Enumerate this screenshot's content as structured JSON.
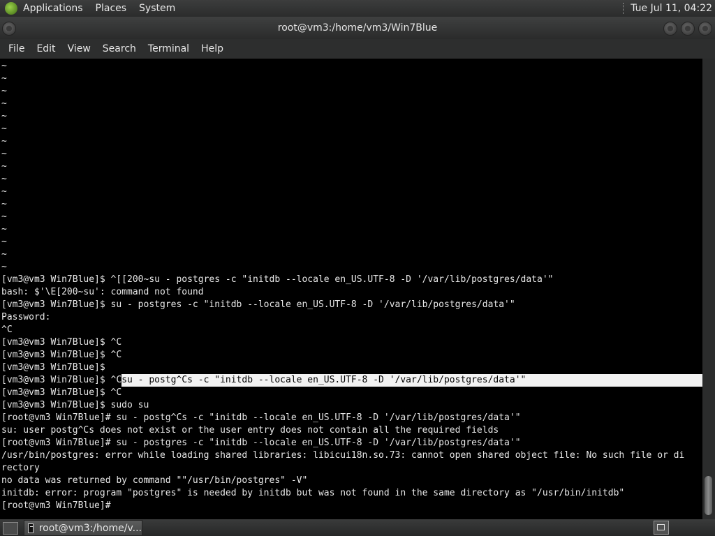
{
  "top_panel": {
    "menus": [
      "Applications",
      "Places",
      "System"
    ],
    "clock": "Tue Jul 11, 04:22"
  },
  "window": {
    "title": "root@vm3:/home/vm3/Win7Blue"
  },
  "menubar": {
    "items": [
      "File",
      "Edit",
      "View",
      "Search",
      "Terminal",
      "Help"
    ]
  },
  "terminal": {
    "lines": [
      "~",
      "~",
      "~",
      "~",
      "~",
      "~",
      "~",
      "~",
      "~",
      "~",
      "~",
      "~",
      "~",
      "~",
      "~",
      "~",
      "~",
      "[vm3@vm3 Win7Blue]$ ^[[200~su - postgres -c \"initdb --locale en_US.UTF-8 -D '/var/lib/postgres/data'\"",
      "bash: $'\\E[200~su': command not found",
      "[vm3@vm3 Win7Blue]$ su - postgres -c \"initdb --locale en_US.UTF-8 -D '/var/lib/postgres/data'\"",
      "Password:",
      "^C",
      "[vm3@vm3 Win7Blue]$ ^C",
      "[vm3@vm3 Win7Blue]$ ^C",
      "[vm3@vm3 Win7Blue]$ ",
      "[vm3@vm3 Win7Blue]$ ^C",
      "[vm3@vm3 Win7Blue]$ ^C",
      "[vm3@vm3 Win7Blue]$ sudo su",
      "[root@vm3 Win7Blue]# su - postg^Cs -c \"initdb --locale en_US.UTF-8 -D '/var/lib/postgres/data'\"",
      "su: user postg^Cs does not exist or the user entry does not contain all the required fields",
      "[root@vm3 Win7Blue]# su - postgres -c \"initdb --locale en_US.UTF-8 -D '/var/lib/postgres/data'\"",
      "/usr/bin/postgres: error while loading shared libraries: libicui18n.so.73: cannot open shared object file: No such file or di",
      "rectory",
      "no data was returned by command \"\"/usr/bin/postgres\" -V\"",
      "initdb: error: program \"postgres\" is needed by initdb but was not found in the same directory as \"/usr/bin/initdb\"",
      "[root@vm3 Win7Blue]# "
    ],
    "highlighted_line_index": 25,
    "highlighted_text": "su - postg^Cs -c \"initdb --locale en_US.UTF-8 -D '/var/lib/postgres/data'\"",
    "cursor_line_index": 37
  },
  "taskbar": {
    "task_label": "root@vm3:/home/v..."
  },
  "icons": {
    "app_logo": "distro-logo-icon",
    "show_desktop": "show-desktop-icon",
    "terminal_task": "terminal-icon",
    "workspace": "workspace-switcher-icon"
  }
}
